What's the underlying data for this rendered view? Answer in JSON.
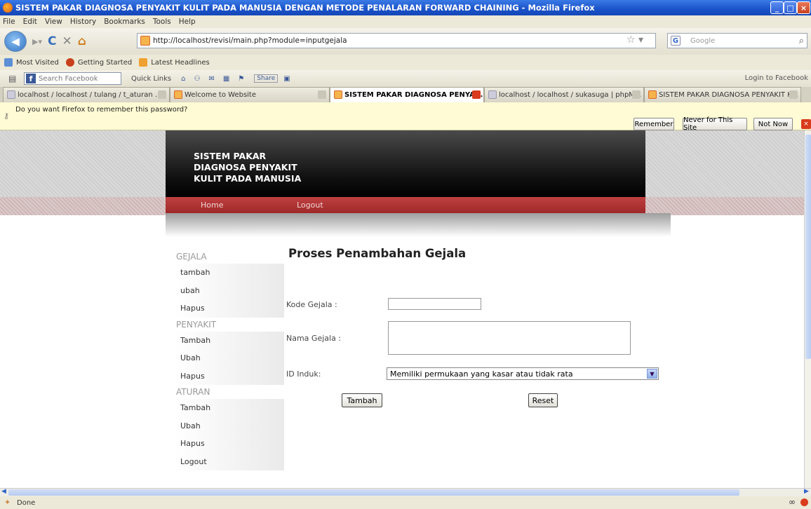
{
  "window": {
    "title": "SISTEM PAKAR DIAGNOSA PENYAKIT KULIT PADA MANUSIA DENGAN METODE PENALARAN FORWARD CHAINING - Mozilla Firefox"
  },
  "menu": [
    "File",
    "Edit",
    "View",
    "History",
    "Bookmarks",
    "Tools",
    "Help"
  ],
  "nav": {
    "url": "http://localhost/revisi/main.php?module=inputgejala",
    "search_placeholder": "Google"
  },
  "bookmarks": [
    "Most Visited",
    "Getting Started",
    "Latest Headlines"
  ],
  "fbtoolbar": {
    "search_placeholder": "Search Facebook",
    "quick_links": "Quick Links",
    "share": "Share",
    "login": "Login to Facebook"
  },
  "tabs": [
    {
      "label": "localhost / localhost / tulang / t_aturan ..."
    },
    {
      "label": "Welcome to Website"
    },
    {
      "label": "SISTEM PAKAR DIAGNOSA PENYA..."
    },
    {
      "label": "localhost / localhost / sukasuga | phpM..."
    },
    {
      "label": "SISTEM PAKAR DIAGNOSA PENYAKIT K..."
    }
  ],
  "notification": {
    "text": "Do you want Firefox to remember this password?",
    "remember": "Remember",
    "never": "Never for This Site",
    "not_now": "Not Now"
  },
  "site": {
    "logo_lines": [
      "SISTEM PAKAR",
      "DIAGNOSA PENYAKIT",
      "KULIT PADA MANUSIA"
    ],
    "nav": [
      "Home",
      "Logout"
    ]
  },
  "sidebar": {
    "sections": [
      {
        "title": "GEJALA",
        "items": [
          "tambah",
          "ubah",
          "Hapus"
        ]
      },
      {
        "title": "PENYAKIT",
        "items": [
          "Tambah",
          "Ubah",
          "Hapus"
        ]
      },
      {
        "title": "ATURAN",
        "items": [
          "Tambah",
          "Ubah",
          "Hapus",
          "Logout"
        ]
      }
    ]
  },
  "form": {
    "heading": "Proses Penambahan Gejala",
    "kode_label": "Kode Gejala :",
    "kode_value": "",
    "nama_label": "Nama Gejala :",
    "nama_value": "",
    "induk_label": "ID Induk:",
    "induk_selected": "Memiliki permukaan yang kasar atau tidak rata",
    "submit": "Tambah",
    "reset": "Reset"
  },
  "status": {
    "text": "Done"
  }
}
